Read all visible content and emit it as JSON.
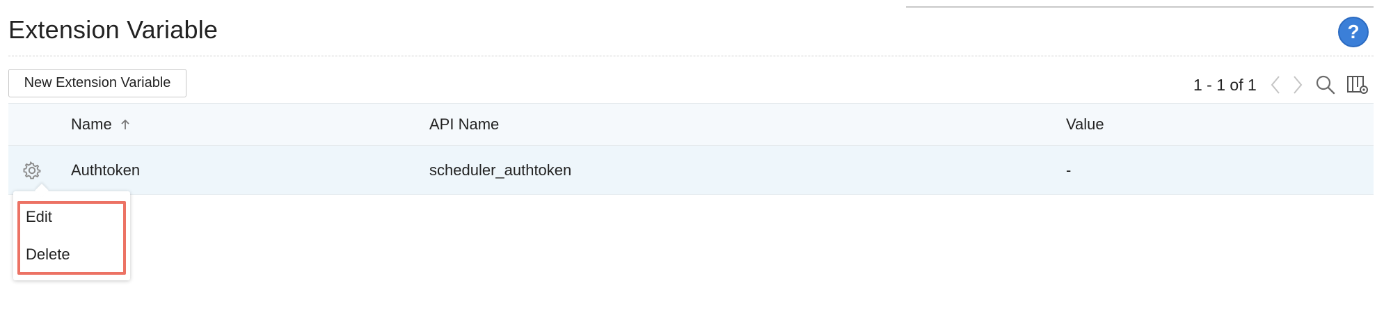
{
  "page": {
    "title": "Extension Variable",
    "help_label": "?"
  },
  "toolbar": {
    "new_button_label": "New Extension Variable",
    "pagination_text": "1 - 1 of 1"
  },
  "table": {
    "columns": [
      "Name",
      "API Name",
      "Value"
    ],
    "sorted_column": "Name",
    "sort_direction": "ascending",
    "rows": [
      {
        "name": "Authtoken",
        "api_name": "scheduler_authtoken",
        "value": "-"
      }
    ]
  },
  "context_menu": {
    "items": [
      "Edit",
      "Delete"
    ]
  },
  "colors": {
    "accent": "#3b7fd8",
    "header_bg": "#f5f9fc",
    "row_bg": "#eef6fb",
    "highlight": "#ec7264"
  },
  "icons": [
    "help-icon",
    "chevron-left-icon",
    "chevron-right-icon",
    "search-icon",
    "column-settings-icon",
    "sort-up-arrow-icon",
    "gear-icon"
  ]
}
